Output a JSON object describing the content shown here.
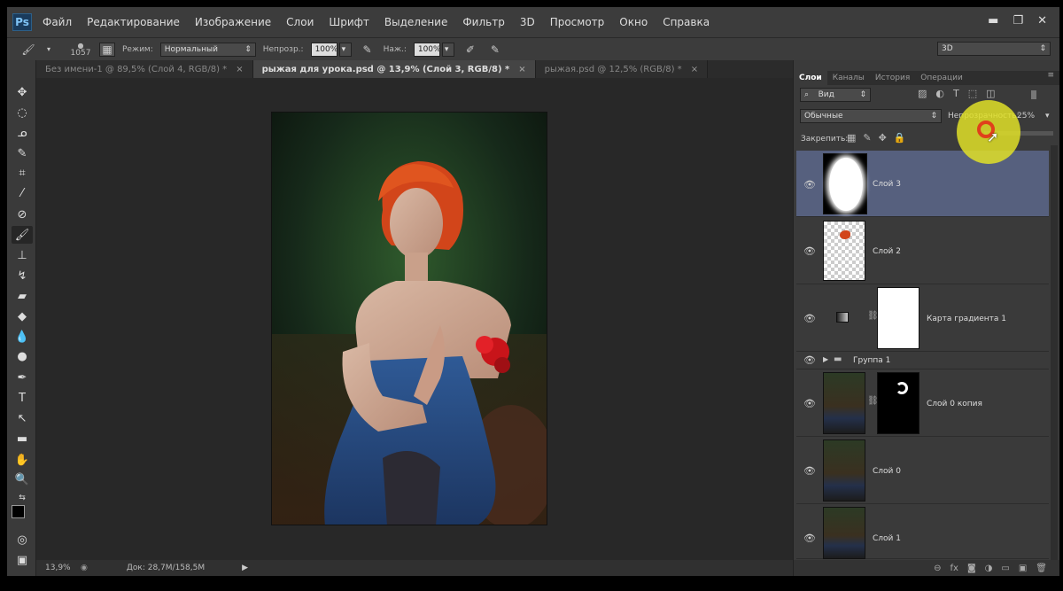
{
  "app": {
    "logo": "Ps"
  },
  "menu": [
    "Файл",
    "Редактирование",
    "Изображение",
    "Слои",
    "Шрифт",
    "Выделение",
    "Фильтр",
    "3D",
    "Просмотр",
    "Окно",
    "Справка"
  ],
  "window_controls": {
    "minimize": "▬",
    "restore": "❐",
    "close": "✕"
  },
  "options": {
    "brush_size": "1057",
    "mode_label": "Режим:",
    "mode_value": "Нормальный",
    "opacity_label": "Непрозр.:",
    "opacity_value": "100%",
    "flow_label": "Наж.:",
    "flow_value": "100%",
    "workspace": "3D"
  },
  "tabs": [
    {
      "title": "Без имени-1 @ 89,5% (Слой 4, RGB/8) *",
      "close": "×"
    },
    {
      "title": "рыжая для урока.psd @ 13,9% (Слой 3, RGB/8) *",
      "close": "×"
    },
    {
      "title": "рыжая.psd @ 12,5% (RGB/8) *",
      "close": "×"
    }
  ],
  "status": {
    "zoom": "13,9%",
    "doc": "Док: 28,7M/158,5M"
  },
  "panel": {
    "tabs": [
      "Слои",
      "Каналы",
      "История",
      "Операции"
    ],
    "filter_label": "Вид",
    "blend_mode": "Обычные",
    "opacity_label": "Непрозрачность:",
    "opacity_value": "25%",
    "lock_label": "Закрепить:",
    "bottom_icons": [
      "⊖",
      "fx",
      "◙",
      "◑",
      "▭",
      "▣",
      "🗑"
    ]
  },
  "layers": [
    {
      "name": "Слой 3"
    },
    {
      "name": "Слой 2"
    },
    {
      "name": "Карта градиента 1"
    },
    {
      "name": "Группа 1"
    },
    {
      "name": "Слой 0 копия"
    },
    {
      "name": "Слой 0"
    },
    {
      "name": "Слой 1"
    }
  ],
  "colors": {
    "accent": "#56607e",
    "cursor_highlight": "#e1e128",
    "menubar": "#3c3c3c"
  }
}
